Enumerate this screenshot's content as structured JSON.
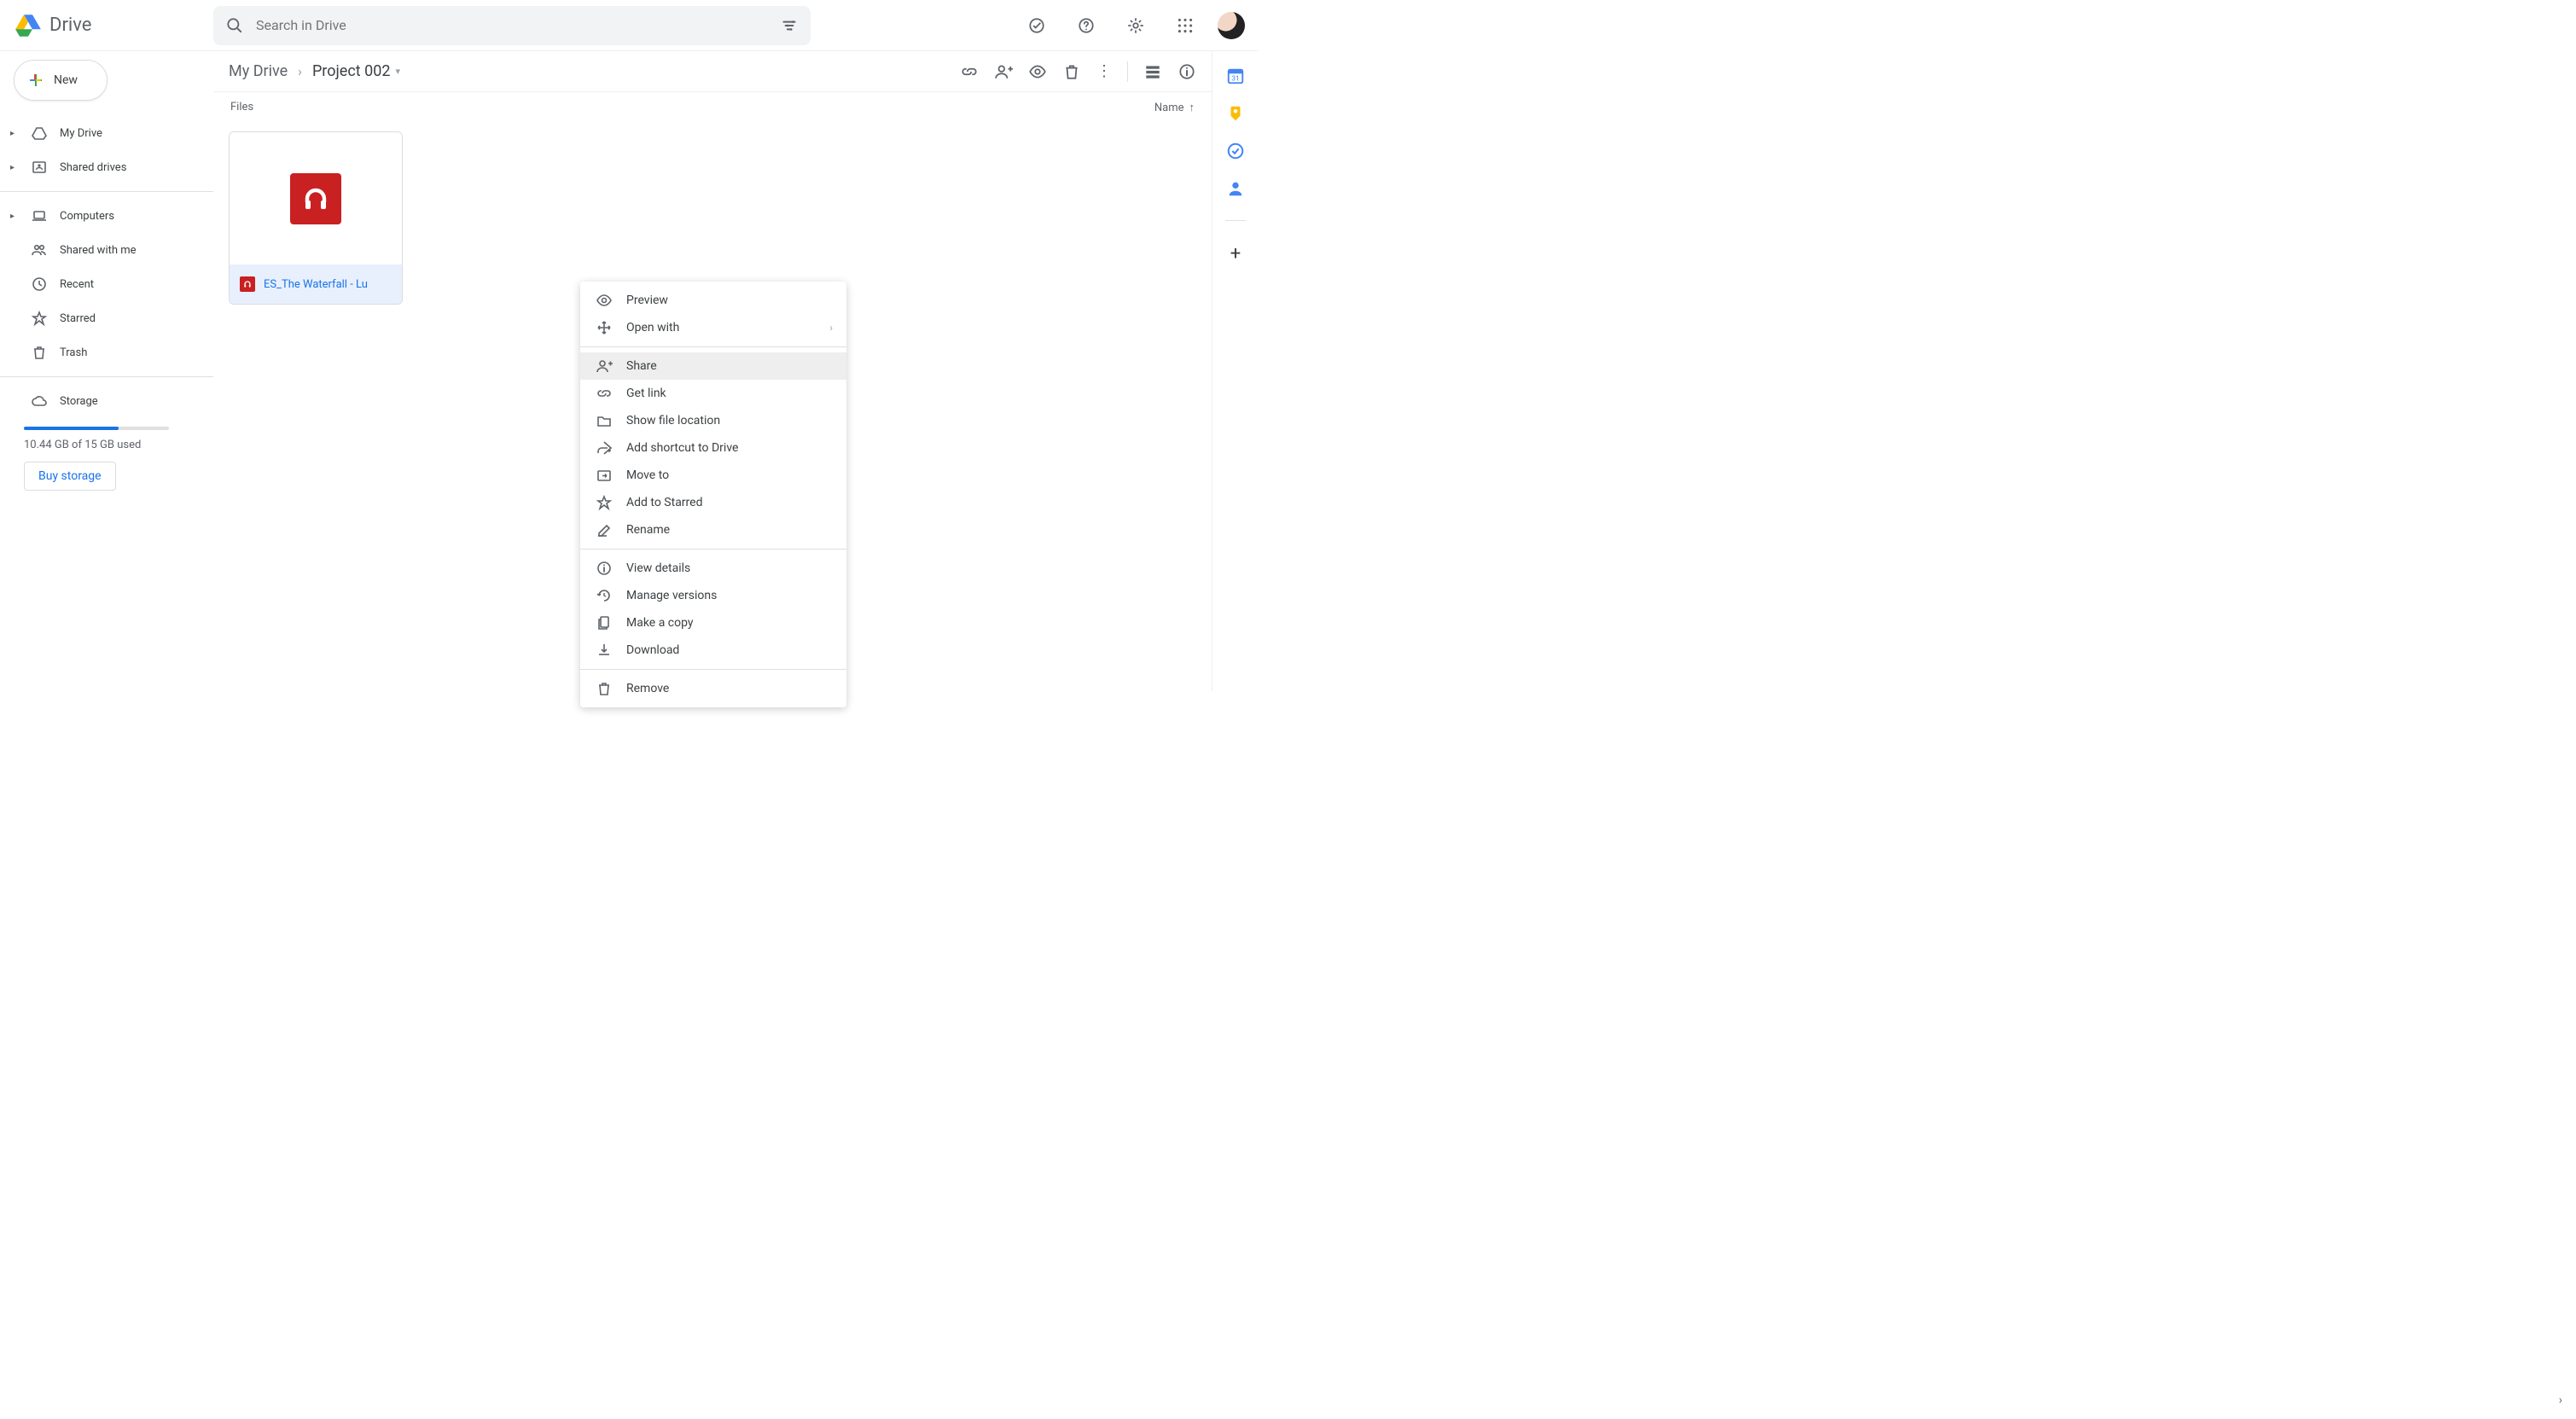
{
  "app": {
    "name": "Drive"
  },
  "search": {
    "placeholder": "Search in Drive"
  },
  "new_button": {
    "label": "New"
  },
  "sidebar": {
    "items": [
      {
        "label": "My Drive",
        "icon": "my-drive-icon",
        "expandable": true
      },
      {
        "label": "Shared drives",
        "icon": "shared-drives-icon",
        "expandable": true
      },
      {
        "label": "Computers",
        "icon": "computers-icon",
        "expandable": true
      },
      {
        "label": "Shared with me",
        "icon": "shared-icon",
        "expandable": false
      },
      {
        "label": "Recent",
        "icon": "recent-icon",
        "expandable": false
      },
      {
        "label": "Starred",
        "icon": "star-icon",
        "expandable": false
      },
      {
        "label": "Trash",
        "icon": "trash-icon",
        "expandable": false
      }
    ],
    "storage_label": "Storage",
    "storage_used": "10.44 GB of 15 GB used",
    "buy_label": "Buy storage"
  },
  "breadcrumb": {
    "root": "My Drive",
    "current": "Project 002"
  },
  "list": {
    "section_label": "Files",
    "sort_label": "Name"
  },
  "files": [
    {
      "name": "ES_The Waterfall - Lu",
      "selected": true
    }
  ],
  "context_menu": {
    "groups": [
      [
        {
          "label": "Preview",
          "icon": "eye-icon"
        },
        {
          "label": "Open with",
          "icon": "open-with-icon",
          "submenu": true
        }
      ],
      [
        {
          "label": "Share",
          "icon": "person-add-icon",
          "hover": true
        },
        {
          "label": "Get link",
          "icon": "link-icon"
        },
        {
          "label": "Show file location",
          "icon": "folder-icon"
        },
        {
          "label": "Add shortcut to Drive",
          "icon": "shortcut-icon"
        },
        {
          "label": "Move to",
          "icon": "move-icon"
        },
        {
          "label": "Add to Starred",
          "icon": "star-icon"
        },
        {
          "label": "Rename",
          "icon": "rename-icon"
        }
      ],
      [
        {
          "label": "View details",
          "icon": "info-icon"
        },
        {
          "label": "Manage versions",
          "icon": "history-icon"
        },
        {
          "label": "Make a copy",
          "icon": "copy-icon"
        },
        {
          "label": "Download",
          "icon": "download-icon"
        }
      ],
      [
        {
          "label": "Remove",
          "icon": "trash-icon"
        }
      ]
    ]
  }
}
